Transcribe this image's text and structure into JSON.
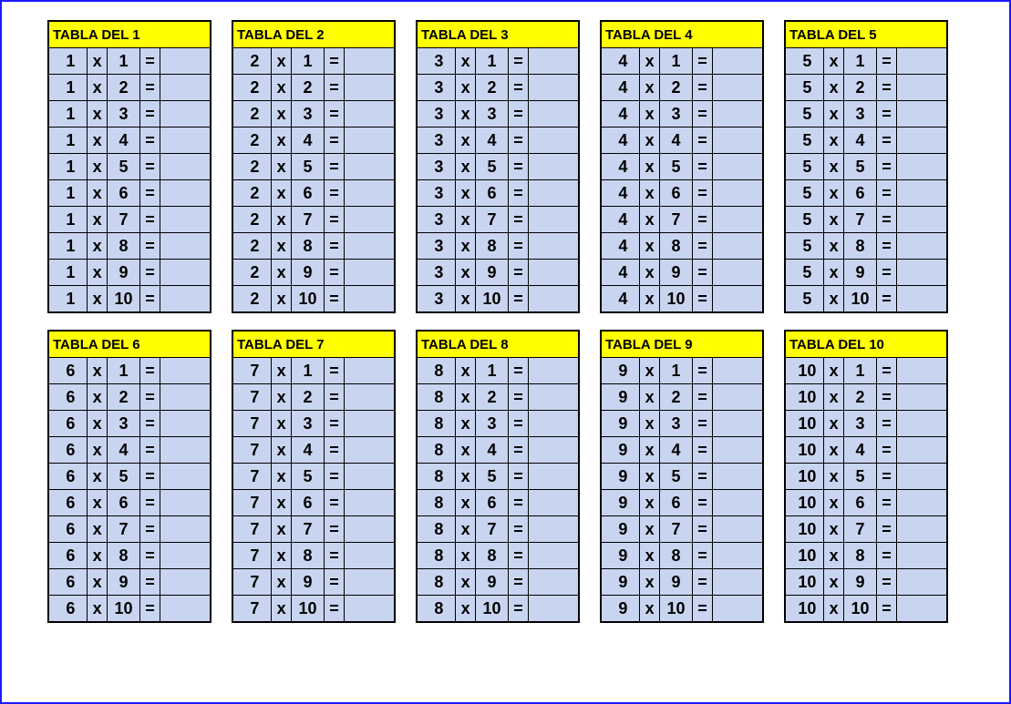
{
  "title_prefix": "TABLA DEL ",
  "operator": "x",
  "equals": "=",
  "tables": [
    {
      "n": 1,
      "title": "TABLA DEL 1"
    },
    {
      "n": 2,
      "title": "TABLA DEL 2"
    },
    {
      "n": 3,
      "title": "TABLA DEL 3"
    },
    {
      "n": 4,
      "title": "TABLA DEL 4"
    },
    {
      "n": 5,
      "title": "TABLA DEL 5"
    },
    {
      "n": 6,
      "title": "TABLA DEL 6"
    },
    {
      "n": 7,
      "title": "TABLA DEL 7"
    },
    {
      "n": 8,
      "title": "TABLA DEL 8"
    },
    {
      "n": 9,
      "title": "TABLA DEL 9"
    },
    {
      "n": 10,
      "title": "TABLA DEL 10"
    }
  ],
  "multipliers": [
    1,
    2,
    3,
    4,
    5,
    6,
    7,
    8,
    9,
    10
  ]
}
